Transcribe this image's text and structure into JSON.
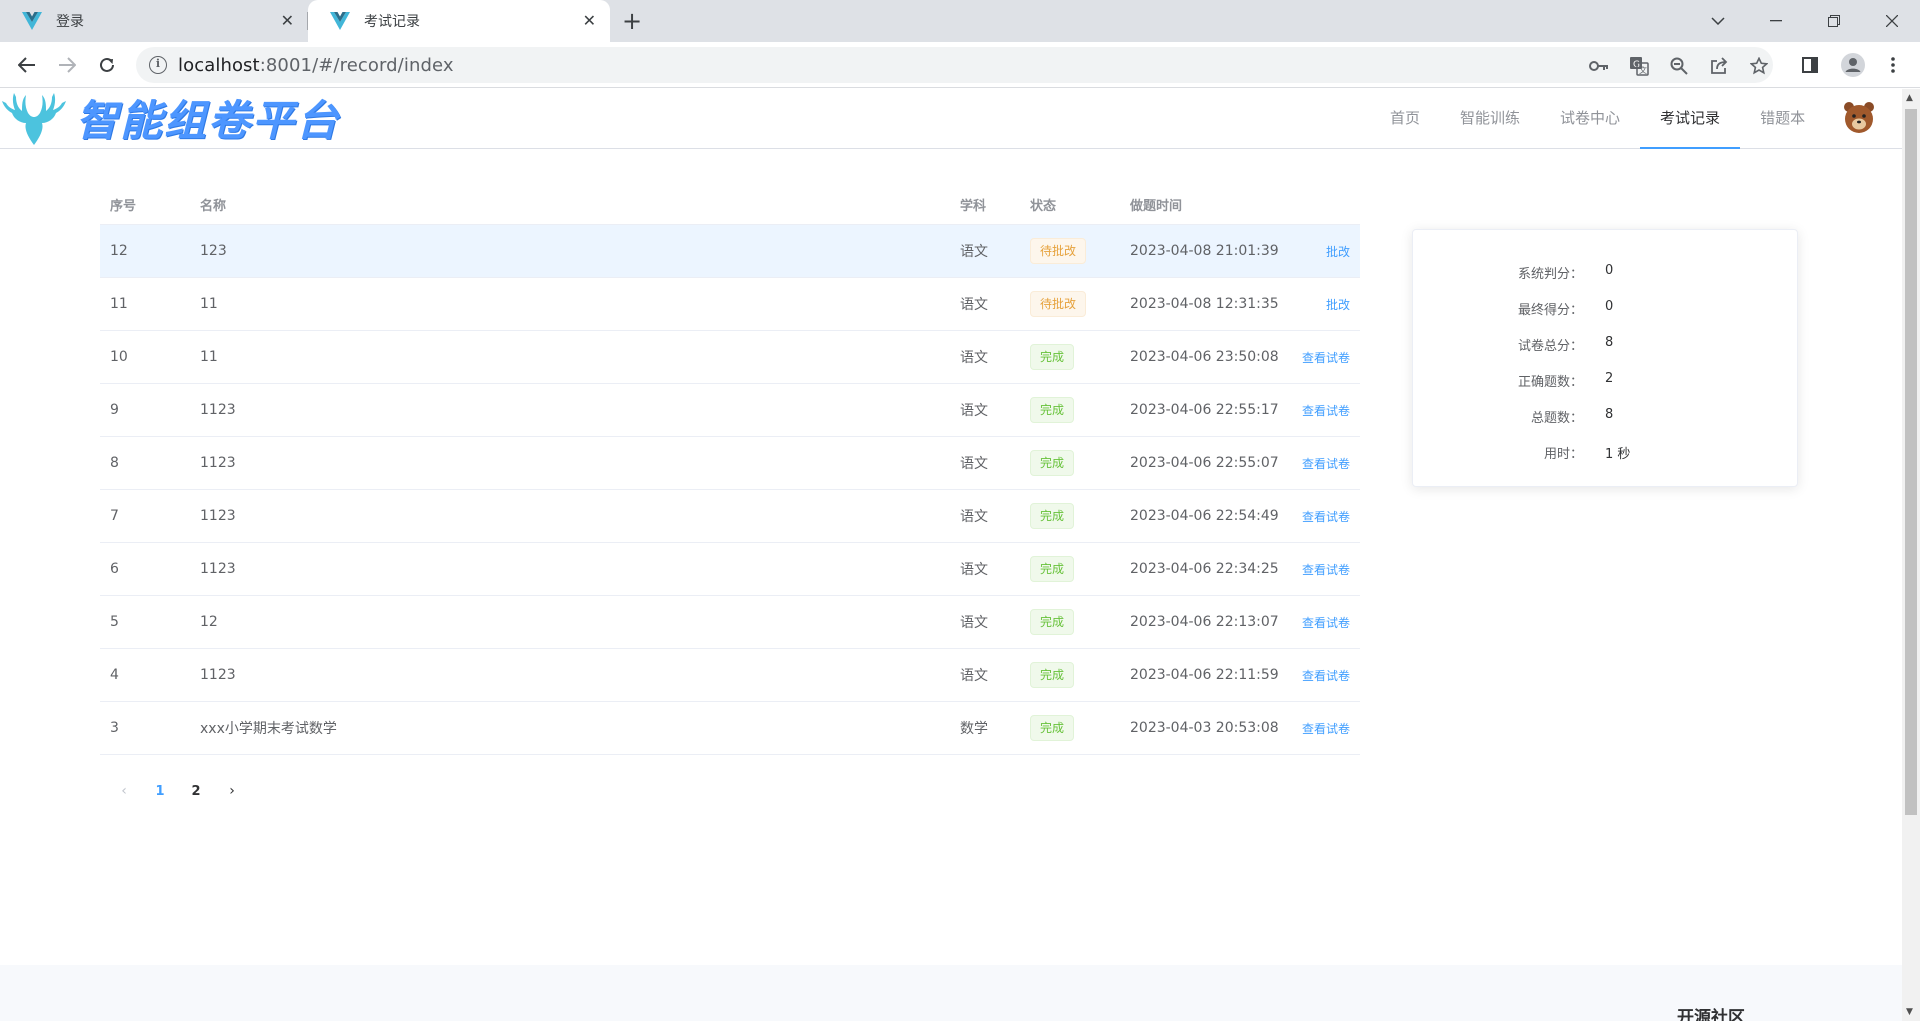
{
  "browser": {
    "tabs": [
      {
        "title": "登录"
      },
      {
        "title": "考试记录"
      }
    ],
    "url_host": "localhost",
    "url_path": ":8001/#/record/index"
  },
  "header": {
    "brand": "智能组卷平台",
    "menu": [
      "首页",
      "智能训练",
      "试卷中心",
      "考试记录",
      "错题本"
    ],
    "active_menu": "考试记录"
  },
  "table": {
    "columns": [
      "序号",
      "名称",
      "学科",
      "状态",
      "做题时间"
    ],
    "rows": [
      {
        "no": "12",
        "name": "123",
        "subject": "语文",
        "status": "待批改",
        "time": "2023-04-08 21:01:39",
        "action": "批改"
      },
      {
        "no": "11",
        "name": "11",
        "subject": "语文",
        "status": "待批改",
        "time": "2023-04-08 12:31:35",
        "action": "批改"
      },
      {
        "no": "10",
        "name": "11",
        "subject": "语文",
        "status": "完成",
        "time": "2023-04-06 23:50:08",
        "action": "查看试卷"
      },
      {
        "no": "9",
        "name": "1123",
        "subject": "语文",
        "status": "完成",
        "time": "2023-04-06 22:55:17",
        "action": "查看试卷"
      },
      {
        "no": "8",
        "name": "1123",
        "subject": "语文",
        "status": "完成",
        "time": "2023-04-06 22:55:07",
        "action": "查看试卷"
      },
      {
        "no": "7",
        "name": "1123",
        "subject": "语文",
        "status": "完成",
        "time": "2023-04-06 22:54:49",
        "action": "查看试卷"
      },
      {
        "no": "6",
        "name": "1123",
        "subject": "语文",
        "status": "完成",
        "time": "2023-04-06 22:34:25",
        "action": "查看试卷"
      },
      {
        "no": "5",
        "name": "12",
        "subject": "语文",
        "status": "完成",
        "time": "2023-04-06 22:13:07",
        "action": "查看试卷"
      },
      {
        "no": "4",
        "name": "1123",
        "subject": "语文",
        "status": "完成",
        "time": "2023-04-06 22:11:59",
        "action": "查看试卷"
      },
      {
        "no": "3",
        "name": "xxx小学期末考试数学",
        "subject": "数学",
        "status": "完成",
        "time": "2023-04-03 20:53:08",
        "action": "查看试卷"
      }
    ]
  },
  "pagination": {
    "prev": "‹",
    "pages": [
      "1",
      "2"
    ],
    "current": "1",
    "next": "›"
  },
  "stats": [
    {
      "label": "系统判分：",
      "value": "0"
    },
    {
      "label": "最终得分：",
      "value": "0"
    },
    {
      "label": "试卷总分：",
      "value": "8"
    },
    {
      "label": "正确题数：",
      "value": "2"
    },
    {
      "label": "总题数：",
      "value": "8"
    },
    {
      "label": "用时：",
      "value": "1 秒"
    }
  ],
  "footer": {
    "title": "开源社区"
  },
  "colors": {
    "accent": "#409eff",
    "warning": "#e6a23c",
    "success": "#67c23a",
    "brand": "#4d96ff"
  },
  "icons": {
    "tab_favicon": "vue-logo-icon",
    "back": "arrow-left-icon",
    "forward": "arrow-right-icon",
    "reload": "reload-icon",
    "site_info": "info-icon",
    "password": "key-icon",
    "translate": "translate-icon",
    "zoom": "zoom-out-icon",
    "share": "share-icon",
    "bookmark": "star-icon",
    "sidepanel": "sidepanel-icon",
    "profile": "profile-icon",
    "more": "kebab-menu-icon",
    "logo": "deer-logo-icon",
    "avatar": "bear-avatar-icon"
  }
}
